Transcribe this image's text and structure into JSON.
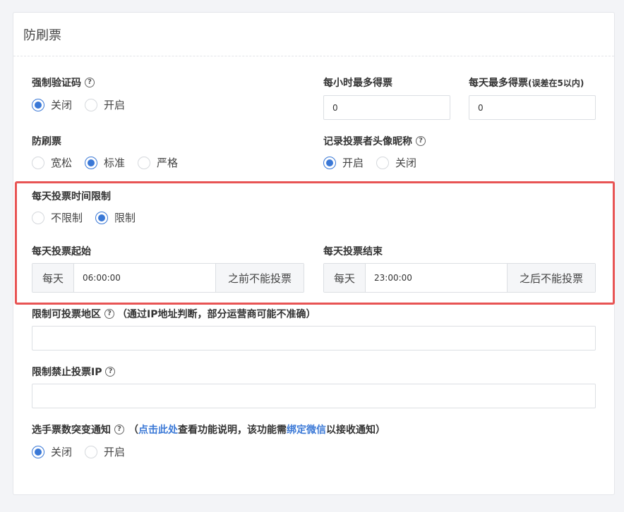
{
  "panel": {
    "title": "防刷票"
  },
  "captcha": {
    "label": "强制验证码",
    "options": [
      "关闭",
      "开启"
    ],
    "selected": 0
  },
  "hourly_max": {
    "label": "每小时最多得票",
    "value": "0"
  },
  "daily_max": {
    "label": "每天最多得票",
    "note": "(误差在5以内)",
    "value": "0"
  },
  "anti_brush": {
    "label": "防刷票",
    "options": [
      "宽松",
      "标准",
      "严格"
    ],
    "selected": 1
  },
  "record_avatar": {
    "label": "记录投票者头像昵称",
    "options": [
      "开启",
      "关闭"
    ],
    "selected": 0
  },
  "time_limit": {
    "label": "每天投票时间限制",
    "options": [
      "不限制",
      "限制"
    ],
    "selected": 1
  },
  "start": {
    "label": "每天投票起始",
    "prefix": "每天",
    "value": "06:00:00",
    "suffix": "之前不能投票"
  },
  "end": {
    "label": "每天投票结束",
    "prefix": "每天",
    "value": "23:00:00",
    "suffix": "之后不能投票"
  },
  "region": {
    "label": "限制可投票地区",
    "note": "（通过IP地址判断，部分运营商可能不准确）",
    "value": ""
  },
  "ban_ip": {
    "label": "限制禁止投票IP",
    "value": ""
  },
  "notify": {
    "label": "选手票数突变通知",
    "note_open": "（",
    "link1": "点击此处",
    "note_mid": "查看功能说明，该功能需",
    "link2": "绑定微信",
    "note_close": "以接收通知）",
    "options": [
      "关闭",
      "开启"
    ],
    "selected": 0
  },
  "colors": {
    "accent": "#3a78d6",
    "highlight": "#e85454"
  }
}
